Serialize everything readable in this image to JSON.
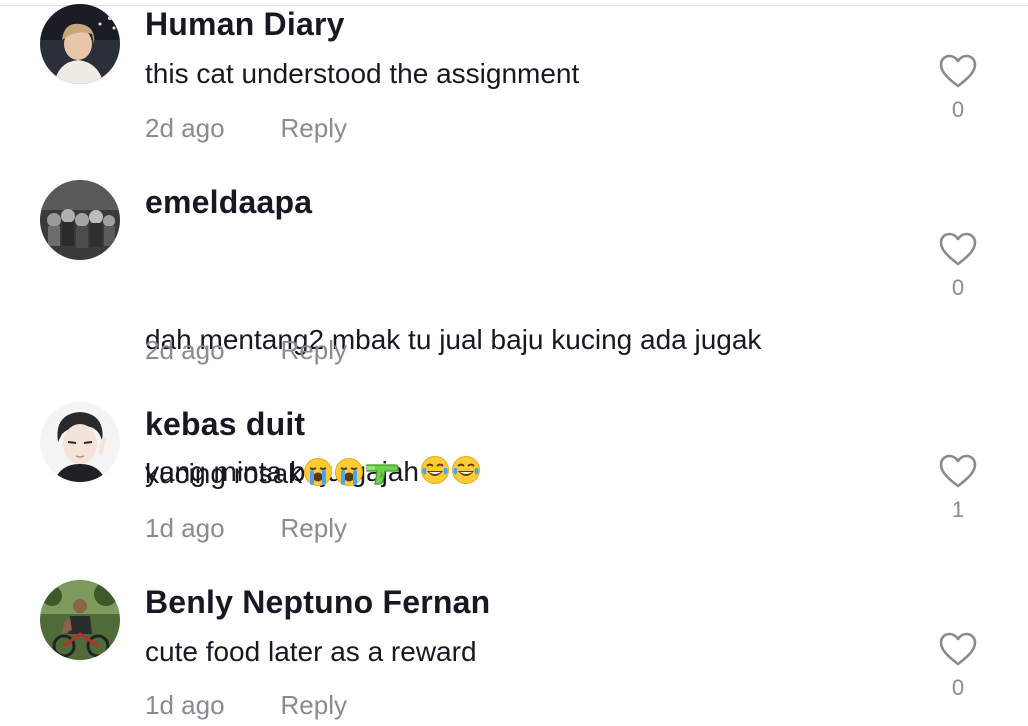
{
  "comments": [
    {
      "username": "Human Diary",
      "text": "this cat understood the assignment",
      "time": "2d ago",
      "reply_label": "Reply",
      "likes": "0"
    },
    {
      "username": "emeldaapa",
      "text_line1": "dah mentang2 mbak tu jual baju kucing ada jugak",
      "text_line2": "yang minta baju gajah",
      "emojis": [
        "face-with-tears-of-joy-icon",
        "face-with-tears-of-joy-icon"
      ],
      "time": "2d ago",
      "reply_label": "Reply",
      "likes": "0"
    },
    {
      "username": "kebas duit",
      "text": "kucing rosak",
      "emojis": [
        "loudly-crying-face-icon",
        "loudly-crying-face-icon",
        "water-pistol-icon"
      ],
      "time": "1d ago",
      "reply_label": "Reply",
      "likes": "1"
    },
    {
      "username": "Benly Neptuno Fernan",
      "text": "cute food later as a reward",
      "time": "1d ago",
      "reply_label": "Reply",
      "likes": "0"
    }
  ],
  "colors": {
    "text": "#161823",
    "muted": "#8a8b91",
    "heart_outline": "#8a8b91"
  }
}
